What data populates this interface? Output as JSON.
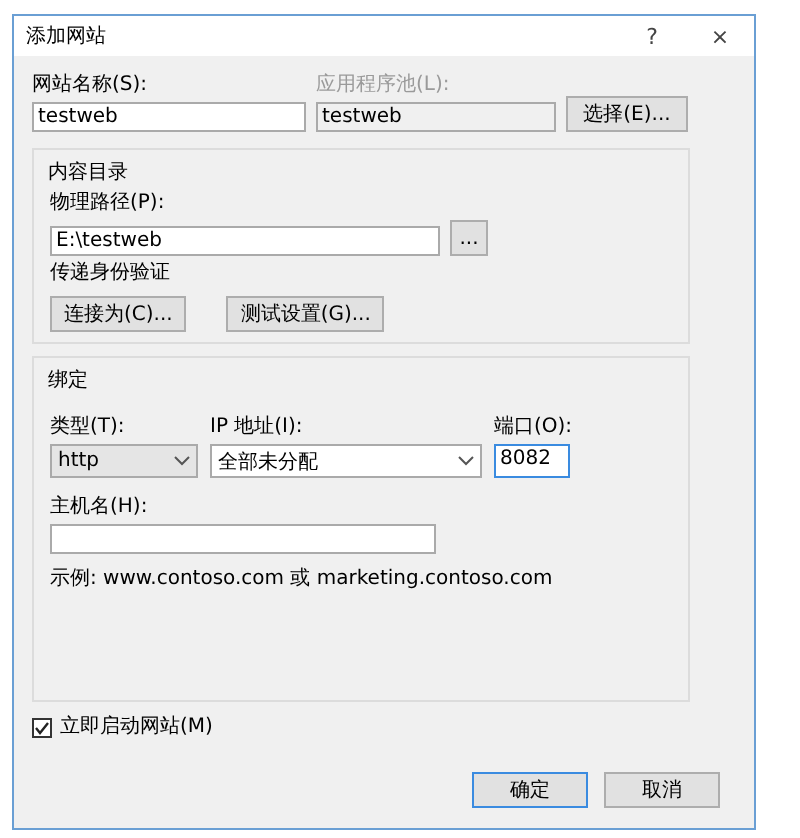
{
  "window": {
    "title": "添加网站",
    "help": "?",
    "close": "×"
  },
  "site_name": {
    "label": "网站名称(S):",
    "value": "testweb"
  },
  "app_pool": {
    "label": "应用程序池(L):",
    "value": "testweb",
    "disabled": true
  },
  "select_button": "选择(E)...",
  "content_directory": {
    "title": "内容目录",
    "path_label": "物理路径(P):",
    "path_value": "E:\\testweb",
    "browse_button": "...",
    "auth_label": "传递身份验证",
    "buttons": [
      "连接为(C)...",
      "测试设置(G)..."
    ]
  },
  "binding": {
    "title": "绑定",
    "type": {
      "label": "类型(T):",
      "value": "http",
      "disabled": true
    },
    "ip": {
      "label": "IP 地址(I):",
      "value": "全部未分配"
    },
    "port": {
      "label": "端口(O):",
      "value": "8082",
      "focused": true
    },
    "host": {
      "label": "主机名(H):"
    },
    "example": "示例: www.contoso.com 或 marketing.contoso.com"
  },
  "start_now": {
    "label": "立即启动网站(M)",
    "checked": true
  },
  "buttons": [
    {
      "label": "确定",
      "default": true
    },
    {
      "label": "取消",
      "default": false
    }
  ]
}
